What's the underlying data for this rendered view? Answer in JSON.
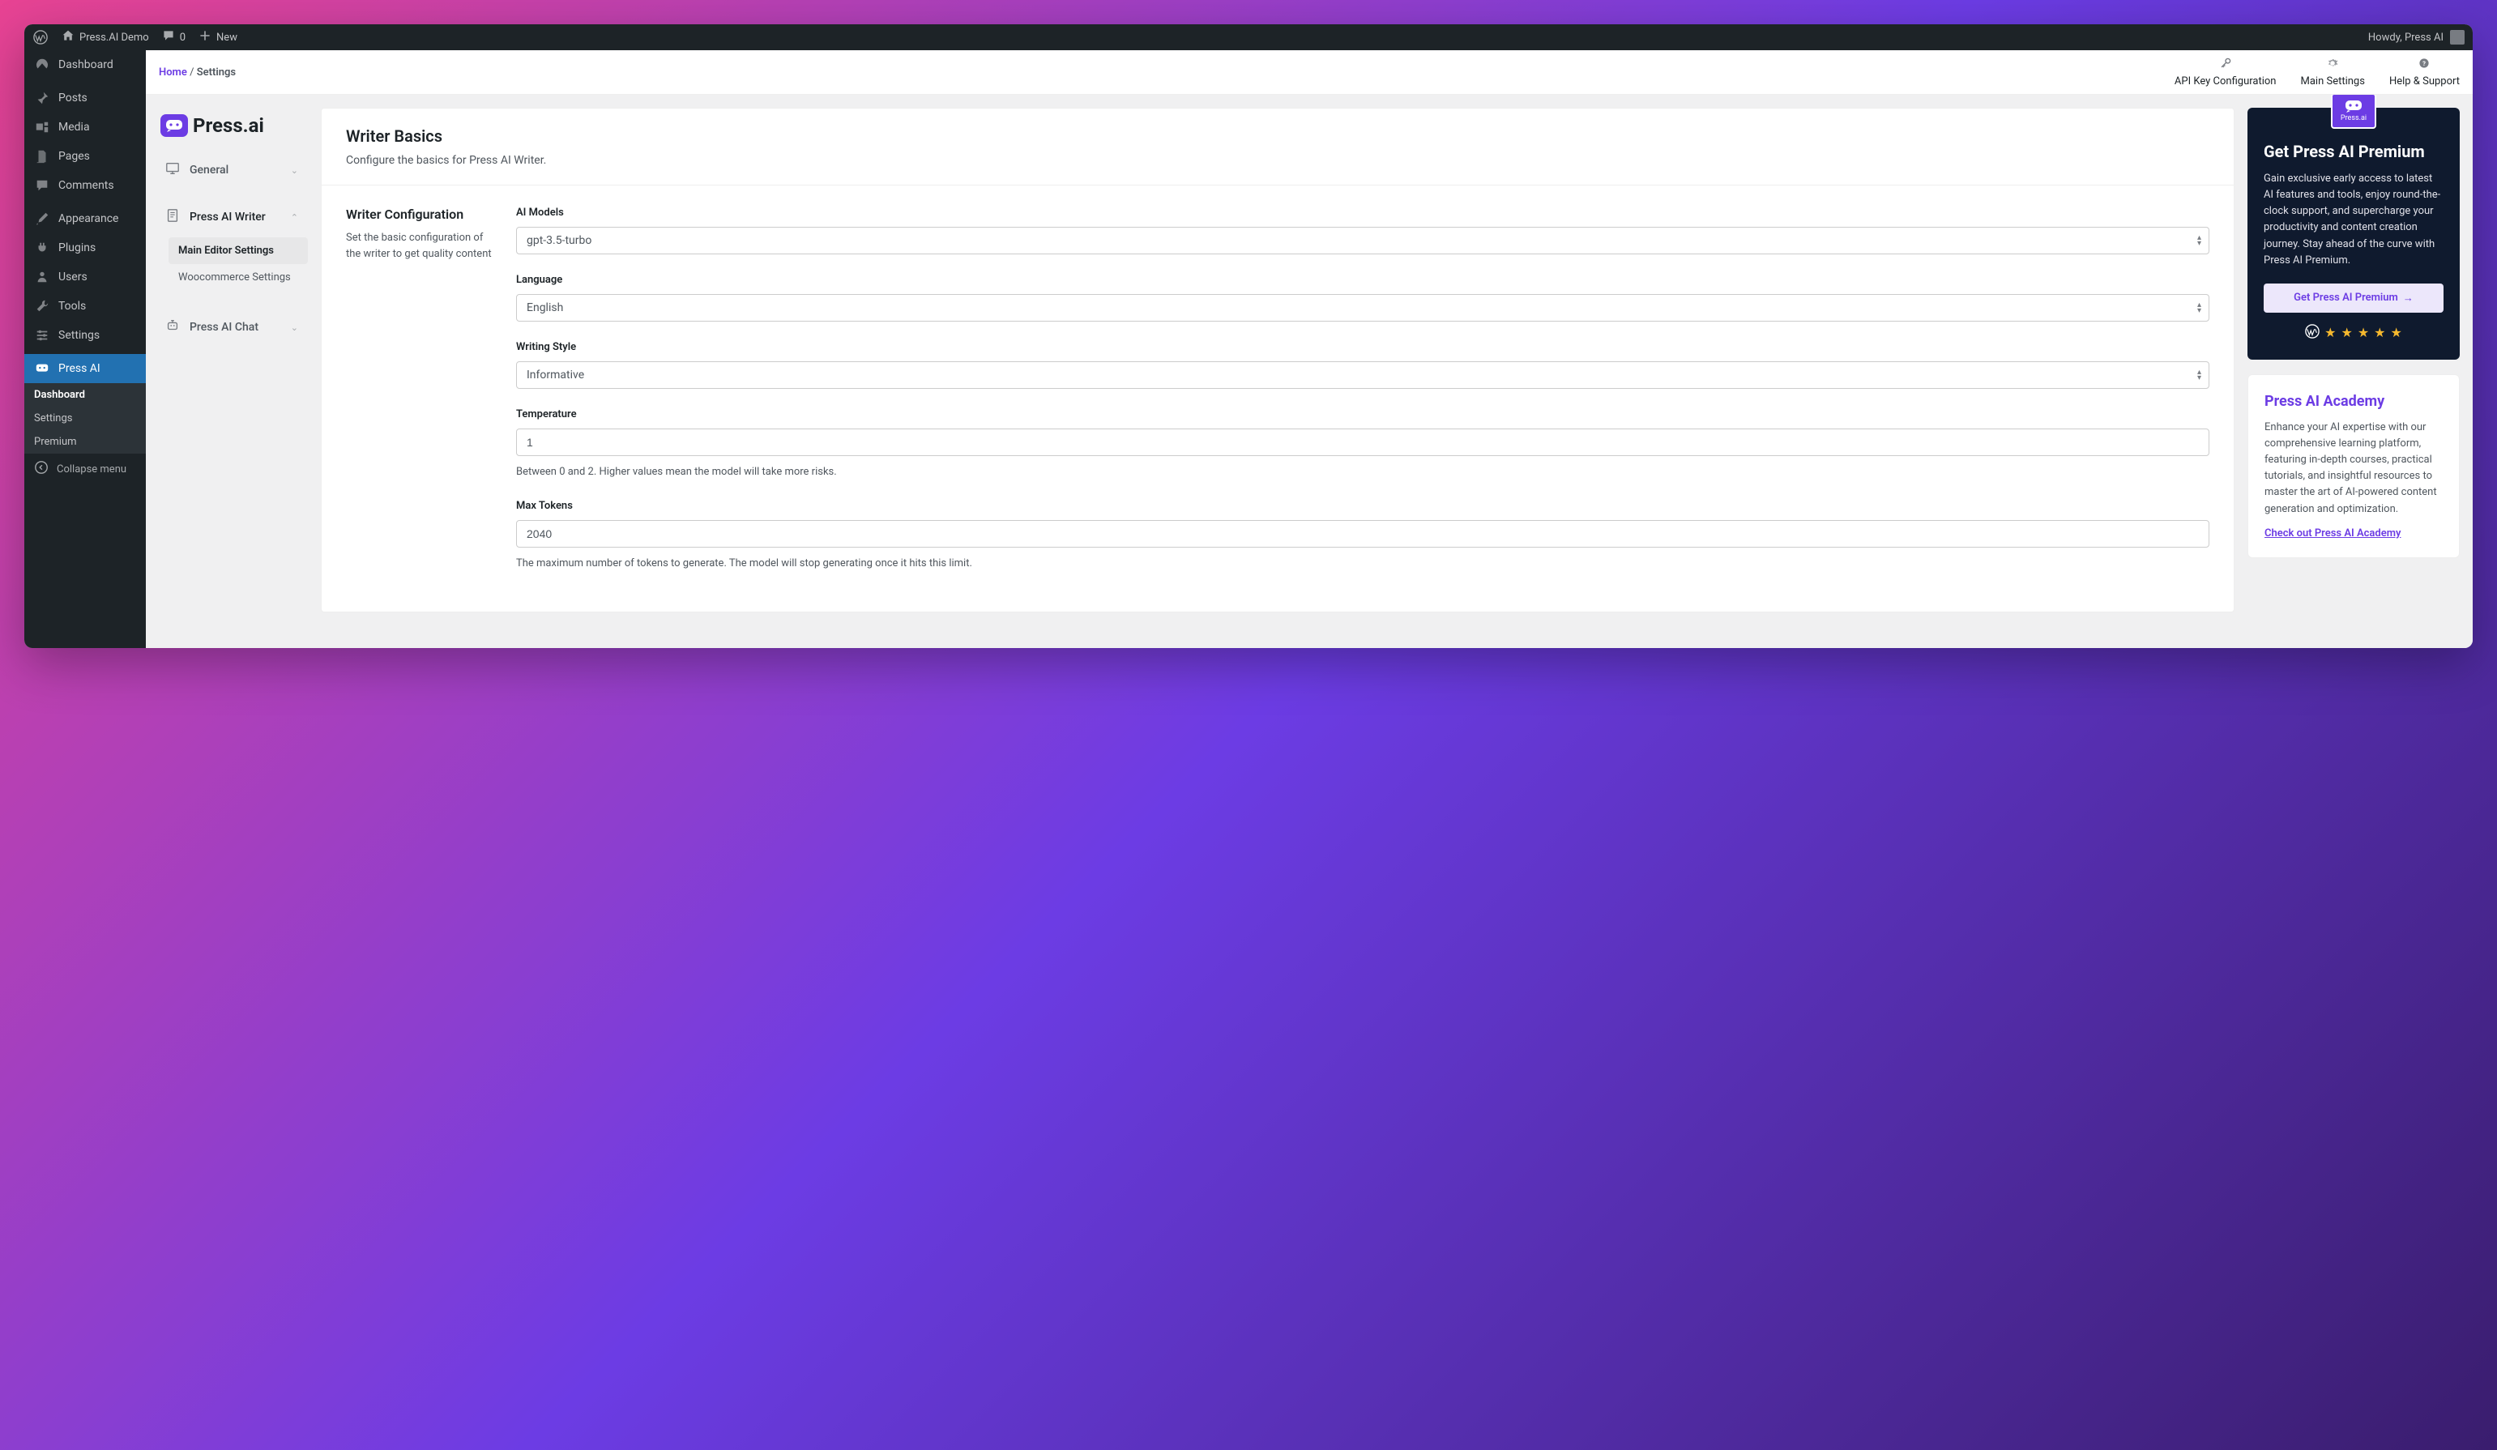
{
  "adminbar": {
    "site_title": "Press.AI Demo",
    "comments_count": "0",
    "new_label": "New",
    "howdy": "Howdy, Press AI"
  },
  "sidebar": {
    "items": [
      {
        "label": "Dashboard",
        "icon": "dash"
      },
      {
        "label": "Posts",
        "icon": "pin"
      },
      {
        "label": "Media",
        "icon": "media"
      },
      {
        "label": "Pages",
        "icon": "pages"
      },
      {
        "label": "Comments",
        "icon": "comment"
      },
      {
        "label": "Appearance",
        "icon": "brush"
      },
      {
        "label": "Plugins",
        "icon": "plug"
      },
      {
        "label": "Users",
        "icon": "user"
      },
      {
        "label": "Tools",
        "icon": "wrench"
      },
      {
        "label": "Settings",
        "icon": "sliders"
      },
      {
        "label": "Press AI",
        "icon": "chat",
        "active": true
      }
    ],
    "submenu": [
      "Dashboard",
      "Settings",
      "Premium"
    ],
    "collapse": "Collapse menu"
  },
  "breadcrumb": {
    "home": "Home",
    "sep": " / ",
    "current": "Settings"
  },
  "topnav_tabs": [
    {
      "label": "API Key Configuration",
      "icon": "key"
    },
    {
      "label": "Main Settings",
      "icon": "gear"
    },
    {
      "label": "Help & Support",
      "icon": "help"
    }
  ],
  "brand": {
    "name": "Press.ai"
  },
  "inner_nav": [
    {
      "label": "General",
      "icon": "monitor",
      "expanded": false
    },
    {
      "label": "Press AI Writer",
      "icon": "doc",
      "expanded": true,
      "children": [
        "Main Editor Settings",
        "Woocommerce Settings"
      ],
      "active_child": 0
    },
    {
      "label": "Press AI Chat",
      "icon": "robot",
      "expanded": false
    }
  ],
  "card": {
    "title": "Writer Basics",
    "subtitle": "Configure the basics for Press AI Writer.",
    "section_title": "Writer Configuration",
    "section_desc": "Set the basic configuration of the writer to get quality content"
  },
  "fields": {
    "ai_models": {
      "label": "AI Models",
      "value": "gpt-3.5-turbo"
    },
    "language": {
      "label": "Language",
      "value": "English"
    },
    "writing_style": {
      "label": "Writing Style",
      "value": "Informative"
    },
    "temperature": {
      "label": "Temperature",
      "value": "1",
      "help": "Between 0 and 2. Higher values mean the model will take more risks."
    },
    "max_tokens": {
      "label": "Max Tokens",
      "value": "2040",
      "help": "The maximum number of tokens to generate. The model will stop generating once it hits this limit."
    }
  },
  "premium": {
    "logo_text": "Press.ai",
    "title": "Get Press AI Premium",
    "text": "Gain exclusive early access to latest AI features and tools, enjoy round-the-clock support, and supercharge your productivity and content creation journey. Stay ahead of the curve with Press AI Premium.",
    "button": "Get Press AI Premium"
  },
  "academy": {
    "title": "Press AI Academy",
    "text": "Enhance your AI expertise with our comprehensive learning platform, featuring in-depth courses, practical tutorials, and insightful resources to master the art of AI-powered content generation and optimization.",
    "link": "Check out Press AI Academy"
  }
}
